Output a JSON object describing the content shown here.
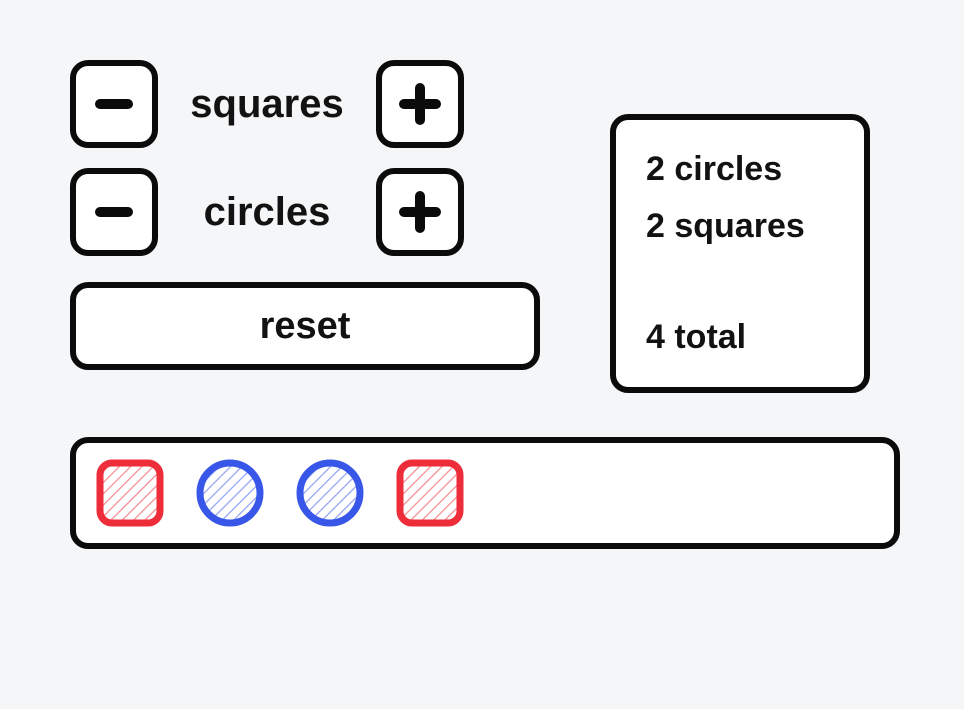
{
  "steppers": {
    "squares": {
      "label": "squares"
    },
    "circles": {
      "label": "circles"
    }
  },
  "reset": {
    "label": "reset"
  },
  "summary": {
    "circles_line": "2 circles",
    "squares_line": "2 squares",
    "total_line": "4 total"
  },
  "shapes": {
    "sequence": [
      "square",
      "circle",
      "circle",
      "square"
    ],
    "colors": {
      "square": "#ed2d3a",
      "circle": "#3857e8"
    }
  }
}
